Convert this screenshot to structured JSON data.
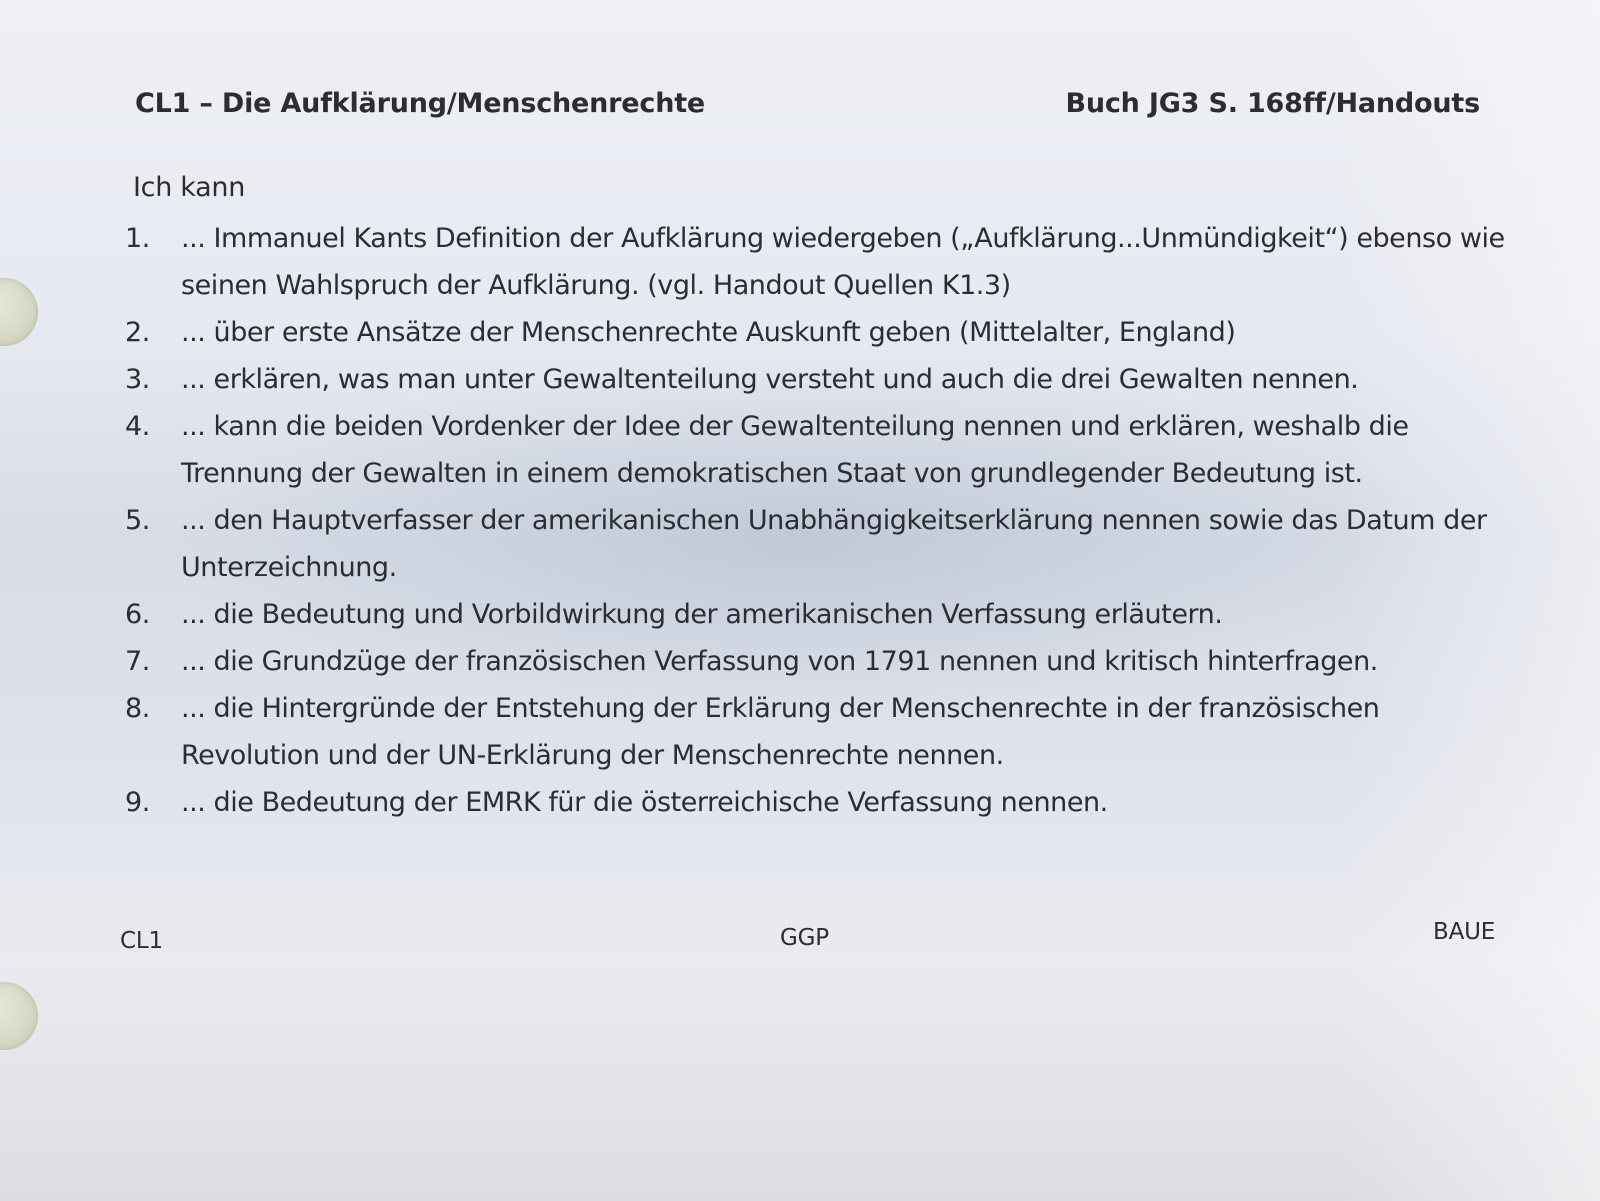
{
  "header": {
    "title": "CL1 – Die Aufklärung/Menschenrechte",
    "reference": "Buch JG3 S. 168ff/Handouts"
  },
  "intro": "Ich kann",
  "items": [
    {
      "number": "1.",
      "text": "... Immanuel Kants Definition der Aufklärung wiedergeben („Aufklärung...Unmündigkeit“) ebenso wie seinen Wahlspruch der Aufklärung. (vgl. Handout Quellen K1.3)"
    },
    {
      "number": "2.",
      "text": "... über erste Ansätze der Menschenrechte Auskunft geben (Mittelalter, England)"
    },
    {
      "number": "3.",
      "text": "... erklären, was man unter Gewaltenteilung versteht und auch die drei Gewalten nennen."
    },
    {
      "number": "4.",
      "text": "... kann die beiden Vordenker der Idee der Gewaltenteilung nennen und erklären, weshalb die Trennung der Gewalten in einem demokratischen Staat von grundlegender Bedeutung ist."
    },
    {
      "number": "5.",
      "text": "... den Hauptverfasser der amerikanischen Unabhängigkeitserklärung nennen sowie das Datum der Unterzeichnung."
    },
    {
      "number": "6.",
      "text": "... die Bedeutung und Vorbildwirkung der amerikanischen Verfassung erläutern."
    },
    {
      "number": "7.",
      "text": "... die Grundzüge der französischen Verfassung von 1791 nennen und kritisch hinterfragen."
    },
    {
      "number": "8.",
      "text": "... die Hintergründe der Entstehung der Erklärung der Menschenrechte in der französischen Revolution und der UN-Erklärung der Menschenrechte nennen."
    },
    {
      "number": "9.",
      "text": "... die Bedeutung der EMRK für die österreichische Verfassung nennen."
    }
  ],
  "footer": {
    "left": "CL1",
    "center": "GGP",
    "right": "BAUE"
  }
}
